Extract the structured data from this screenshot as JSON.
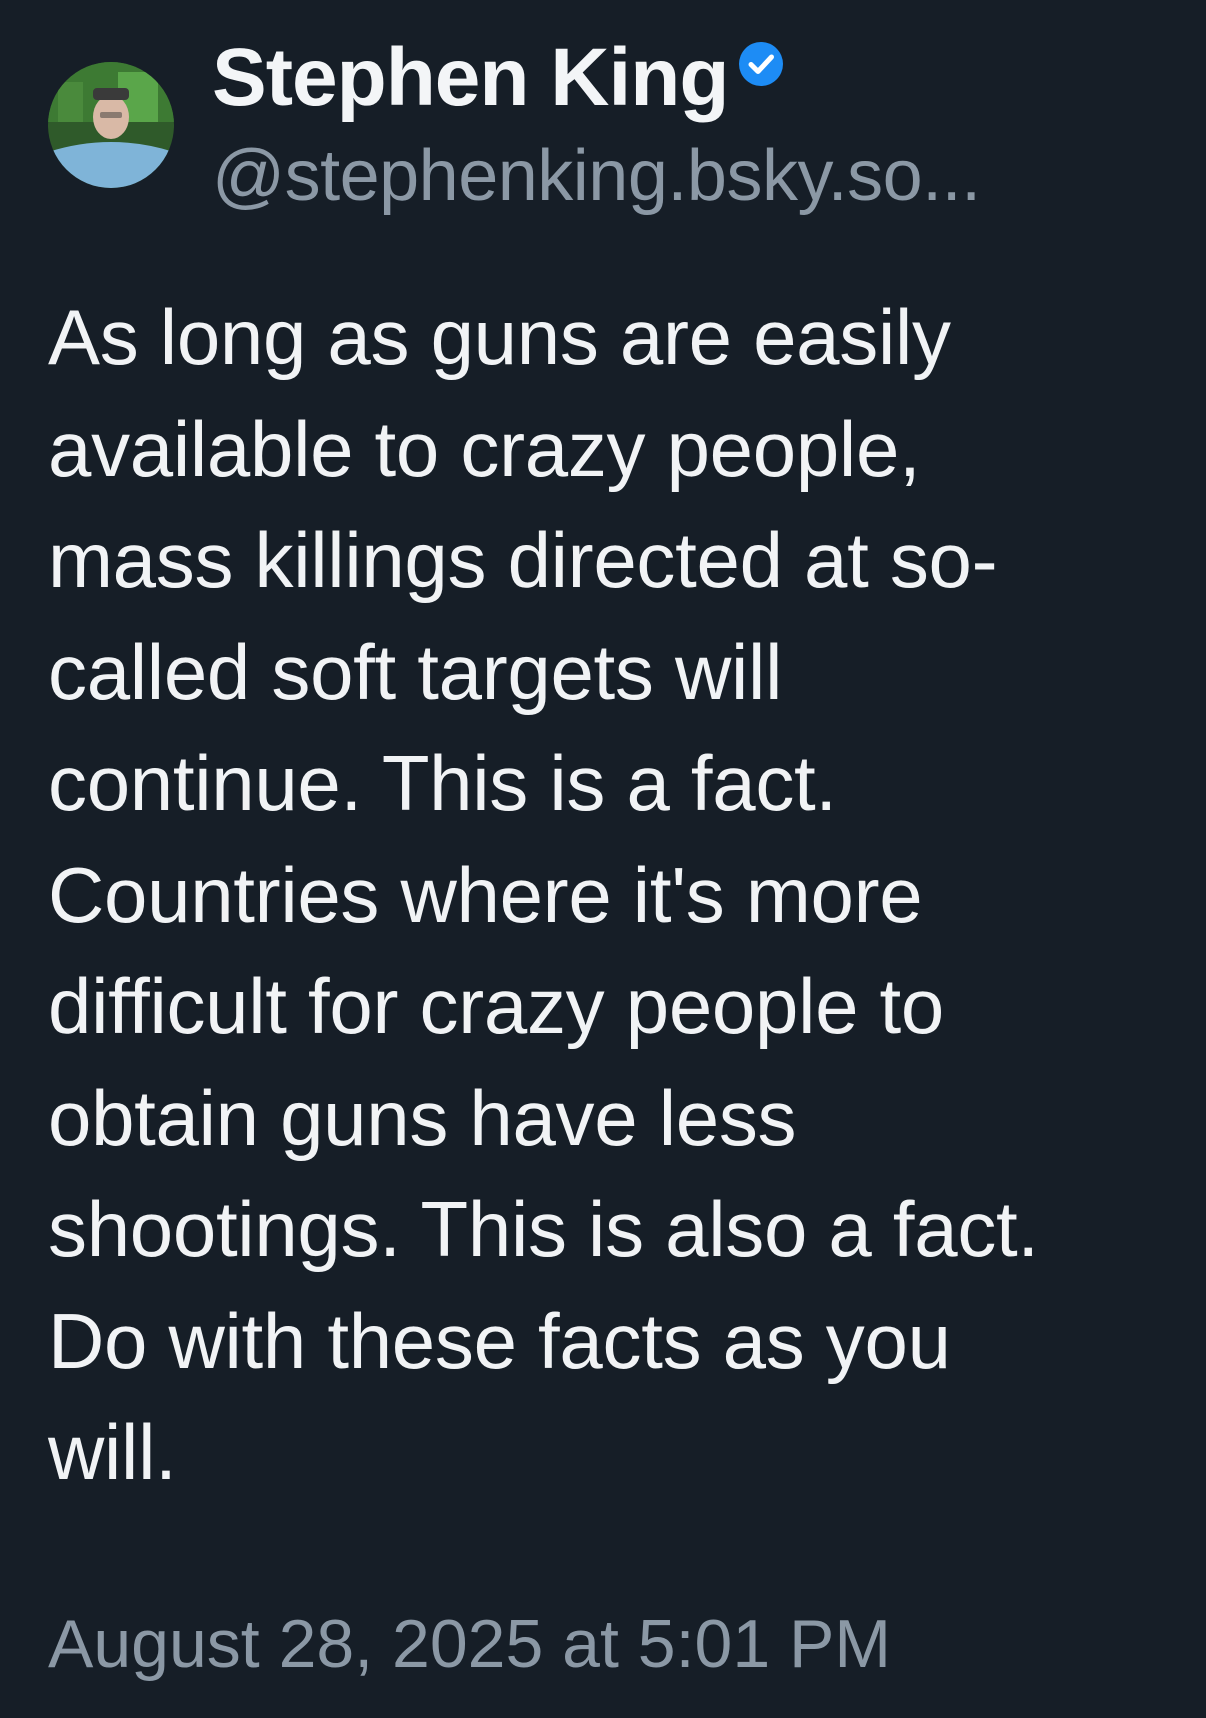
{
  "post": {
    "author": {
      "display_name": "Stephen King",
      "handle": "@stephenking.bsky.so...",
      "verified": true,
      "avatar_icon": "avatar-photo",
      "verified_icon": "verified-check-icon"
    },
    "lines": [
      "As long as guns are easily",
      "available to crazy people,",
      "mass killings directed at so-",
      "called soft targets will",
      "continue. This is a fact.",
      "Countries where it's more",
      "difficult for crazy people to",
      "obtain guns have less",
      "shootings. This is also a fact.",
      "Do with these facts as you",
      "will."
    ],
    "timestamp": "August 28, 2025 at 5:01 PM"
  },
  "colors": {
    "background": "#161e27",
    "text": "#f1f3f5",
    "muted": "#8b98a5",
    "verified": "#1d8cf5"
  }
}
